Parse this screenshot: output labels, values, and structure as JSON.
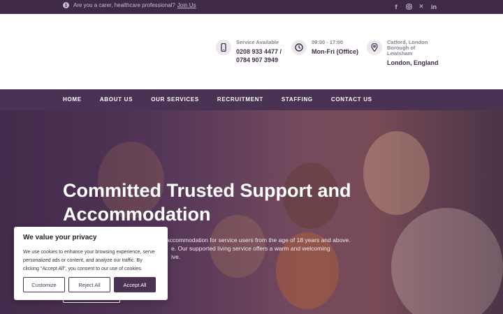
{
  "topbar": {
    "notice_text": "Are you a carer, healthcare professional?",
    "notice_link": "Join Us",
    "social_icons": [
      "facebook-icon",
      "instagram-icon",
      "x-icon",
      "linkedin-icon"
    ]
  },
  "contacts": [
    {
      "icon": "phone-icon",
      "label": "Service Available",
      "lines": [
        "0208 933 4477 /",
        "0784 907 3949"
      ]
    },
    {
      "icon": "clock-icon",
      "label": "09:00 - 17:00",
      "lines": [
        "Mon-Fri (Office)"
      ]
    },
    {
      "icon": "location-icon",
      "label": "Catford, London Borough of Lewisham",
      "lines": [
        "London, England"
      ]
    }
  ],
  "nav": {
    "items": [
      "HOME",
      "ABOUT US",
      "OUR SERVICES",
      "RECRUITMENT",
      "STAFFING",
      "CONTACT US"
    ]
  },
  "hero": {
    "title": "Committed Trusted Support and Accommodation",
    "desc_line1": "accommodation for service users from the age of 18 years and above.",
    "desc_line2": "e. Our supported living service offers a warm and welcoming",
    "desc_line3": "ive."
  },
  "cookie": {
    "title": "We value your privacy",
    "text": "We use cookies to enhance your browsing experience, serve personalized ads or content, and analyze our traffic. By clicking \"Accept All\", you consent to our use of cookies.",
    "customize": "Customize",
    "reject": "Reject All",
    "accept": "Accept All"
  },
  "colors": {
    "brand_dark": "#3e2a48",
    "nav": "#4a3254",
    "white": "#ffffff"
  }
}
